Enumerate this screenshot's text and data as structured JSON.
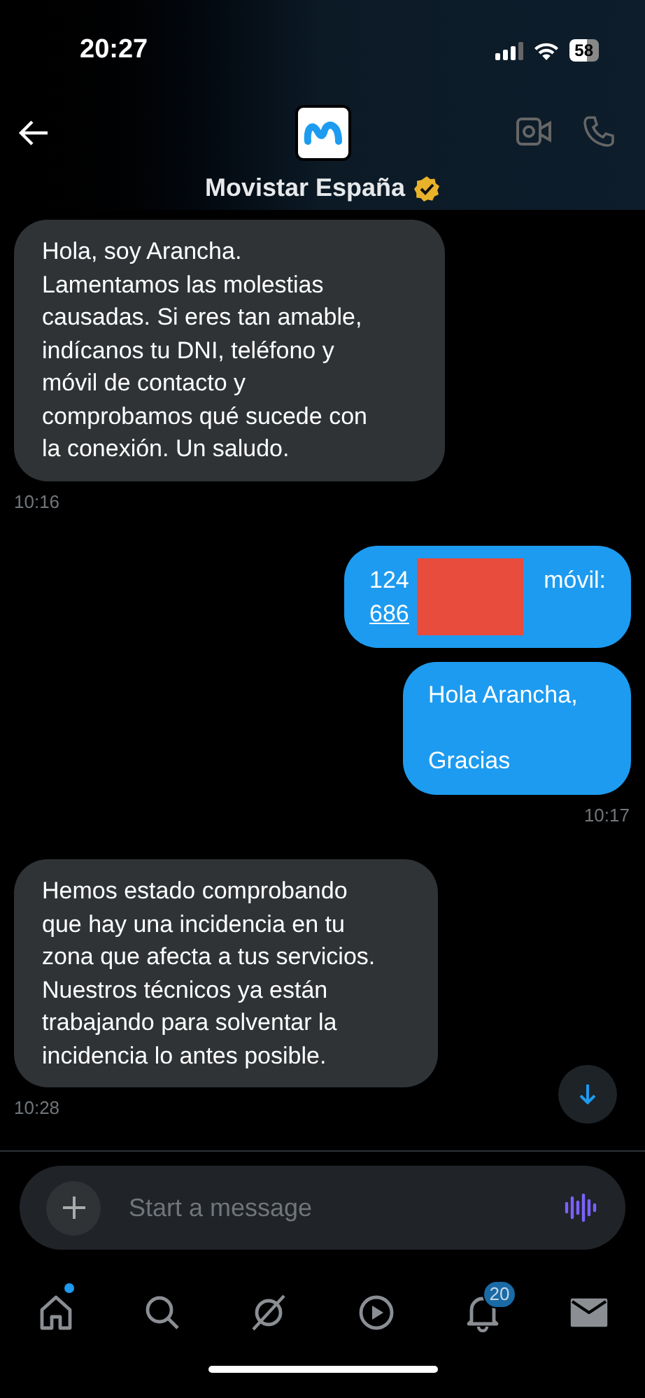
{
  "status_bar": {
    "time": "20:27",
    "battery": "58"
  },
  "header": {
    "title": "Movistar España",
    "verified": true
  },
  "messages": [
    {
      "kind": "text",
      "outgoing": false,
      "text": "Hola, soy Arancha.\nLamentamos las molestias causadas. Si eres tan amable, indícanos tu DNI, teléfono y móvil de contacto y comprobamos qué sucede con la conexión. Un saludo.",
      "time": "10:16"
    },
    {
      "kind": "redacted",
      "outgoing": true,
      "before": "124",
      "after": "móvil:",
      "link": "686"
    },
    {
      "kind": "text",
      "outgoing": true,
      "text": "Hola Arancha,\n\nGracias",
      "time": "10:17"
    },
    {
      "kind": "text",
      "outgoing": false,
      "text": "Hemos estado comprobando que hay una incidencia en tu zona que afecta a tus servicios. Nuestros técnicos ya están trabajando para solventar la incidencia lo antes posible.",
      "time": "10:28"
    }
  ],
  "composer": {
    "placeholder": "Start a message"
  },
  "tabs": [
    {
      "kind": "home",
      "selected": false,
      "dot": true
    },
    {
      "kind": "search",
      "selected": false
    },
    {
      "kind": "grok",
      "selected": false
    },
    {
      "kind": "video",
      "selected": false
    },
    {
      "kind": "bell",
      "selected": false,
      "badge": "20"
    },
    {
      "kind": "mail",
      "selected": true
    }
  ]
}
